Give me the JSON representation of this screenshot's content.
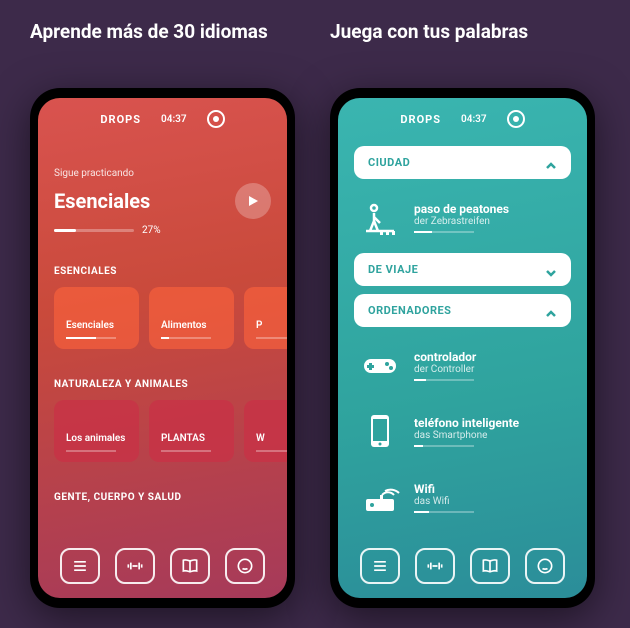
{
  "left": {
    "headline": "Aprende más de 30 idiomas",
    "topbar": {
      "brand": "DROPS",
      "time": "04:37"
    },
    "practice_label": "Sigue practicando",
    "hero_title": "Esenciales",
    "progress_pct": "27%",
    "progress_fill": 27,
    "sections": [
      {
        "label": "ESENCIALES",
        "cards": [
          {
            "title": "Esenciales",
            "progress": 60
          },
          {
            "title": "Alimentos",
            "progress": 15
          },
          {
            "title": "P",
            "progress": 0
          }
        ]
      },
      {
        "label": "NATURALEZA Y ANIMALES",
        "cards": [
          {
            "title": "Los animales",
            "progress": 0
          },
          {
            "title": "PLANTAS",
            "progress": 0
          },
          {
            "title": "W",
            "progress": 0
          }
        ]
      },
      {
        "label": "GENTE, CUERPO Y SALUD",
        "cards": []
      }
    ]
  },
  "right": {
    "headline": "Juega con tus palabras",
    "topbar": {
      "brand": "DROPS",
      "time": "04:37"
    },
    "groups": [
      {
        "label": "CIUDAD",
        "expanded": true,
        "words": [
          {
            "main": "paso de peatones",
            "sub": "der Zebrastreifen",
            "progress": 30,
            "icon": "crosswalk"
          }
        ]
      },
      {
        "label": "DE VIAJE",
        "expanded": false,
        "words": []
      },
      {
        "label": "ORDENADORES",
        "expanded": true,
        "words": [
          {
            "main": "controlador",
            "sub": "der Controller",
            "progress": 20,
            "icon": "gamepad"
          },
          {
            "main": "teléfono inteligente",
            "sub": "das Smartphone",
            "progress": 15,
            "icon": "phone"
          },
          {
            "main": "Wifi",
            "sub": "das Wifi",
            "progress": 25,
            "icon": "wifi"
          }
        ]
      }
    ]
  }
}
